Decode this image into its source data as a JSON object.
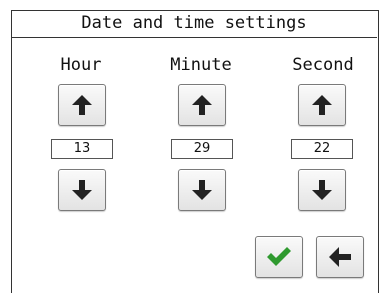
{
  "title": "Date and time settings",
  "columns": [
    {
      "label": "Hour",
      "value": "13"
    },
    {
      "label": "Minute",
      "value": "29"
    },
    {
      "label": "Second",
      "value": "22"
    }
  ],
  "icons": {
    "increment": "arrow-up-icon",
    "decrement": "arrow-down-icon",
    "confirm": "checkmark-icon",
    "back": "arrow-left-icon"
  },
  "colors": {
    "confirm_check": "#2f9a2f",
    "arrow": "#222222",
    "border": "#333333"
  }
}
